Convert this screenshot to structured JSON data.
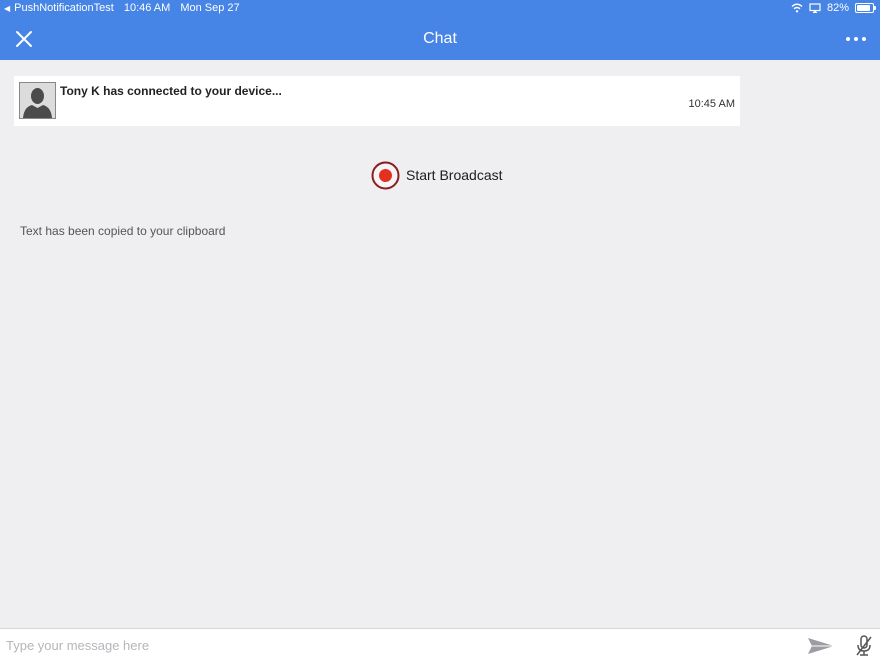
{
  "status_bar": {
    "back_app": "PushNotificationTest",
    "time": "10:46 AM",
    "date": "Mon Sep 27",
    "battery": "82%",
    "icons": [
      "back-arrow-icon",
      "wifi-icon",
      "screen-mirror-icon",
      "battery-icon"
    ]
  },
  "nav": {
    "title": "Chat",
    "close_icon": "close-icon",
    "more_icon": "more-icon"
  },
  "notice": {
    "avatar_icon": "avatar-silhouette-icon",
    "text": "Tony K has connected to your device...",
    "time": "10:45 AM"
  },
  "broadcast": {
    "label": "Start Broadcast",
    "icon": "record-icon",
    "icon_color": "#e2321f"
  },
  "clipboard_message": "Text has been copied to your clipboard",
  "composer": {
    "placeholder": "Type your message here",
    "value": "",
    "send_icon": "send-icon",
    "mic_icon": "mic-off-icon"
  },
  "colors": {
    "header": "#4684e6",
    "background": "#efeef1"
  }
}
